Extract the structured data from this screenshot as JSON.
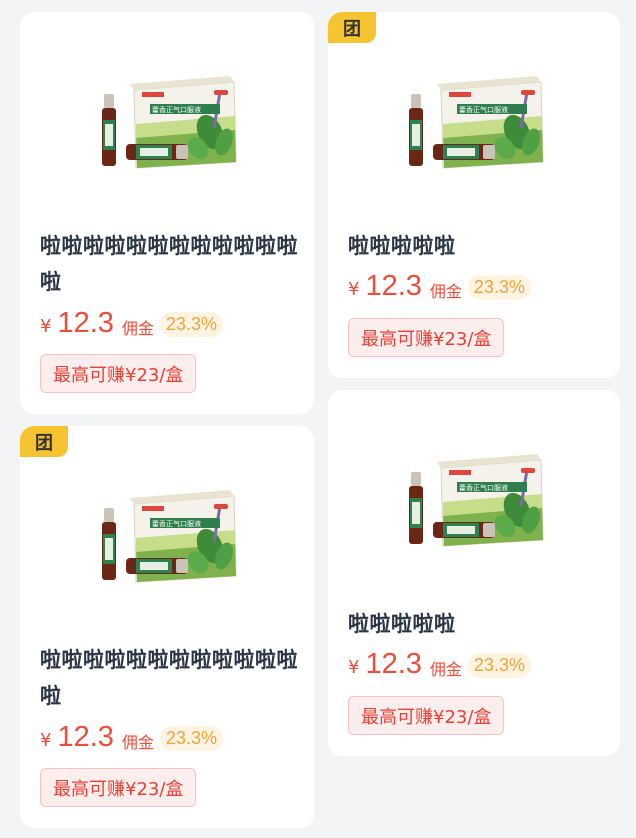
{
  "products": [
    {
      "badge": "",
      "title": "啦啦啦啦啦啦啦啦啦啦啦啦啦",
      "currency": "¥",
      "price": "12.3",
      "commission_label": "佣金",
      "commission_rate": "23.3%",
      "earn_label": "最高可赚¥23/盒",
      "product_image_label": "藿香正气口服液"
    },
    {
      "badge": "团",
      "title": "啦啦啦啦啦",
      "currency": "¥",
      "price": "12.3",
      "commission_label": "佣金",
      "commission_rate": "23.3%",
      "earn_label": "最高可赚¥23/盒",
      "product_image_label": "藿香正气口服液"
    },
    {
      "badge": "团",
      "title": "啦啦啦啦啦啦啦啦啦啦啦啦啦",
      "currency": "¥",
      "price": "12.3",
      "commission_label": "佣金",
      "commission_rate": "23.3%",
      "earn_label": "最高可赚¥23/盒",
      "product_image_label": "藿香正气口服液"
    },
    {
      "badge": "",
      "title": "啦啦啦啦啦",
      "currency": "¥",
      "price": "12.3",
      "commission_label": "佣金",
      "commission_rate": "23.3%",
      "earn_label": "最高可赚¥23/盒",
      "product_image_label": "藿香正气口服液"
    }
  ],
  "colors": {
    "background": "#f3f4f6",
    "card": "#ffffff",
    "badge": "#f7c431",
    "price": "#ee4d3b",
    "commission_text": "#f5a23a",
    "commission_bg": "#fff4e2",
    "earn_text": "#e94036",
    "earn_bg": "#fdeeee"
  }
}
